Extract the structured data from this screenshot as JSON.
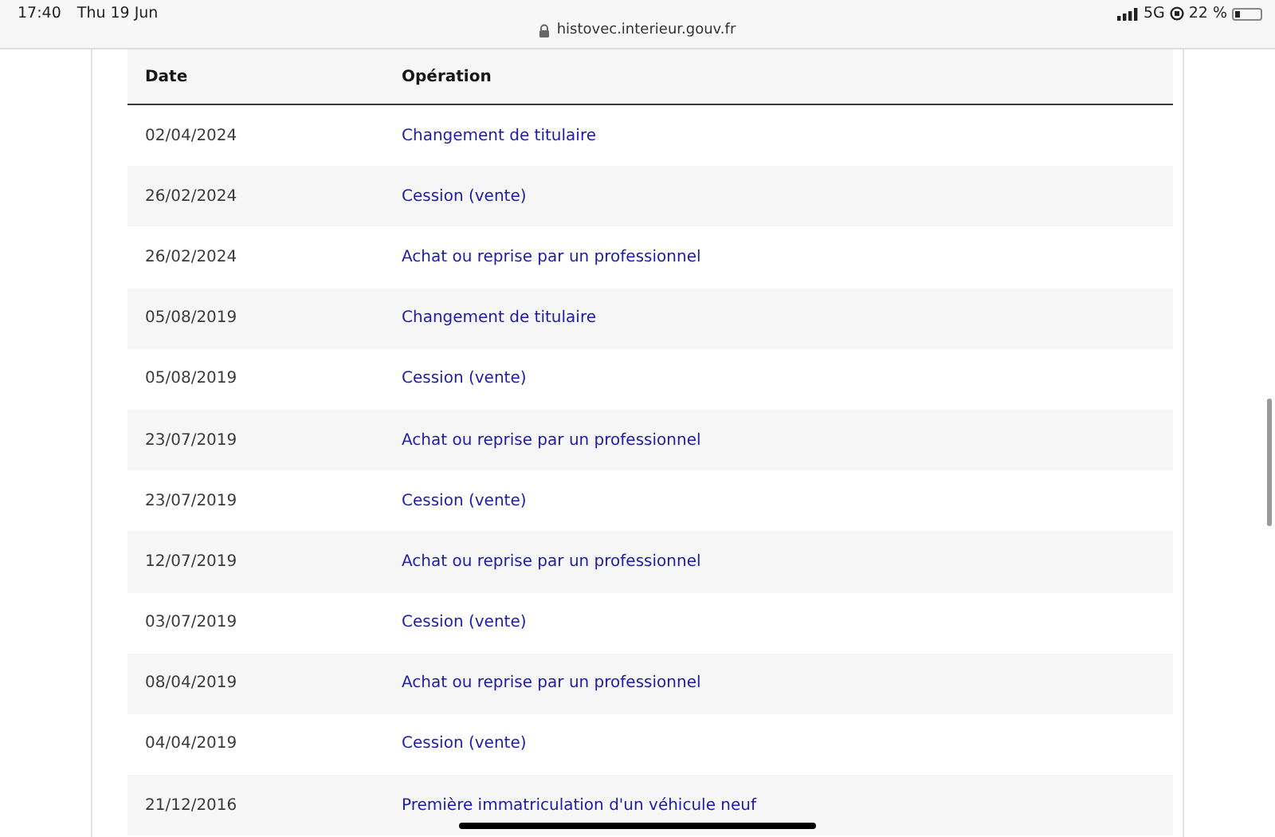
{
  "status_bar": {
    "time": "17:40",
    "date": "Thu 19 Jun",
    "url": "histovec.interieur.gouv.fr",
    "network": "5G",
    "battery": "22 %"
  },
  "table": {
    "columns": [
      "Date",
      "Opération"
    ],
    "rows": [
      {
        "date": "02/04/2024",
        "operation": "Changement de titulaire"
      },
      {
        "date": "26/02/2024",
        "operation": "Cession (vente)"
      },
      {
        "date": "26/02/2024",
        "operation": "Achat ou reprise par un professionnel"
      },
      {
        "date": "05/08/2019",
        "operation": "Changement de titulaire"
      },
      {
        "date": "05/08/2019",
        "operation": "Cession (vente)"
      },
      {
        "date": "23/07/2019",
        "operation": "Achat ou reprise par un professionnel"
      },
      {
        "date": "23/07/2019",
        "operation": "Cession (vente)"
      },
      {
        "date": "12/07/2019",
        "operation": "Achat ou reprise par un professionnel"
      },
      {
        "date": "03/07/2019",
        "operation": "Cession (vente)"
      },
      {
        "date": "08/04/2019",
        "operation": "Achat ou reprise par un professionnel"
      },
      {
        "date": "04/04/2019",
        "operation": "Cession (vente)"
      },
      {
        "date": "21/12/2016",
        "operation": "Première immatriculation d'un véhicule neuf"
      }
    ]
  }
}
